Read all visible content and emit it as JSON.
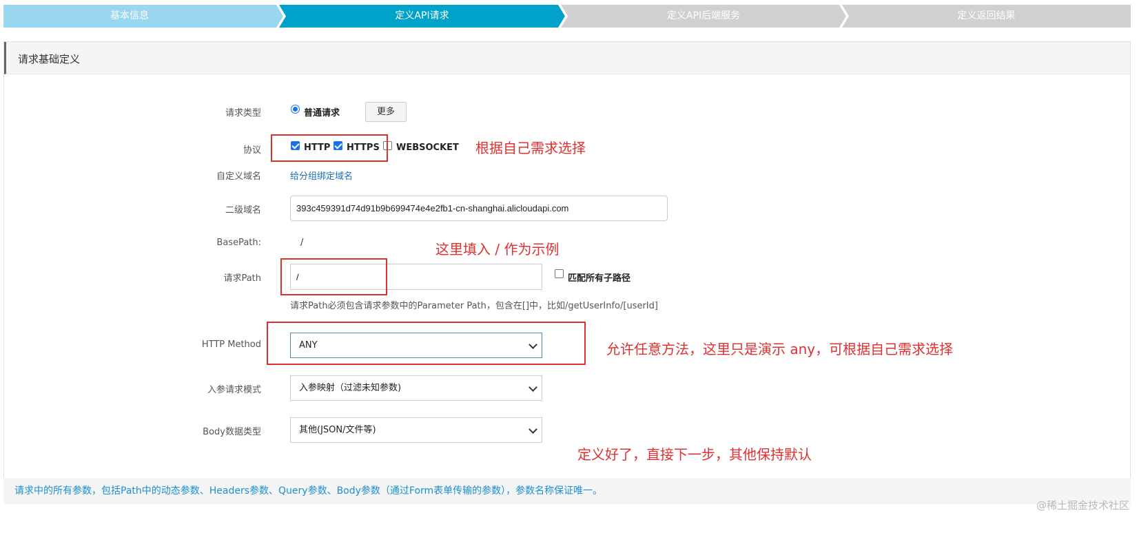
{
  "steps": [
    "基本信息",
    "定义API请求",
    "定义API后端服务",
    "定义返回结果"
  ],
  "panel": {
    "title": "请求基础定义"
  },
  "form": {
    "request_type": {
      "label": "请求类型",
      "option": "普通请求",
      "more_button": "更多"
    },
    "protocol": {
      "label": "协议",
      "http": "HTTP",
      "https": "HTTPS",
      "websocket": "WEBSOCKET",
      "http_checked": true,
      "https_checked": true,
      "websocket_checked": false
    },
    "custom_domain": {
      "label": "自定义域名",
      "link": "给分组绑定域名"
    },
    "subdomain": {
      "label": "二级域名",
      "value": "393c459391d74d91b9b699474e4e2fb1-cn-shanghai.alicloudapi.com"
    },
    "basepath": {
      "label": "BasePath:",
      "value": "/"
    },
    "request_path": {
      "label": "请求Path",
      "value": "/",
      "match_all_label": "匹配所有子路径",
      "hint": "请求Path必须包含请求参数中的Parameter Path，包含在[]中，比如/getUserInfo/[userId]"
    },
    "http_method": {
      "label": "HTTP Method",
      "value": "ANY"
    },
    "param_mode": {
      "label": "入参请求模式",
      "value": "入参映射（过滤未知参数)"
    },
    "body_type": {
      "label": "Body数据类型",
      "value": "其他(JSON/文件等)"
    }
  },
  "annotations": {
    "protocol": "根据自己需求选择",
    "path": "这里填入 / 作为示例",
    "method": "允许任意方法，这里只是演示 any，可根据自己需求选择",
    "done": "定义好了，直接下一步，其他保持默认"
  },
  "note": "请求中的所有参数，包括Path中的动态参数、Headers参数、Query参数、Body参数（通过Form表单传输的参数），参数名称保证唯一。",
  "watermark": "@稀土掘金技术社区",
  "colors": {
    "active_step": "#00a2ca",
    "done_step": "#99d6ef",
    "pending_step": "#d0d0d0",
    "annotation": "#e03030",
    "link": "#1a6ec0"
  }
}
